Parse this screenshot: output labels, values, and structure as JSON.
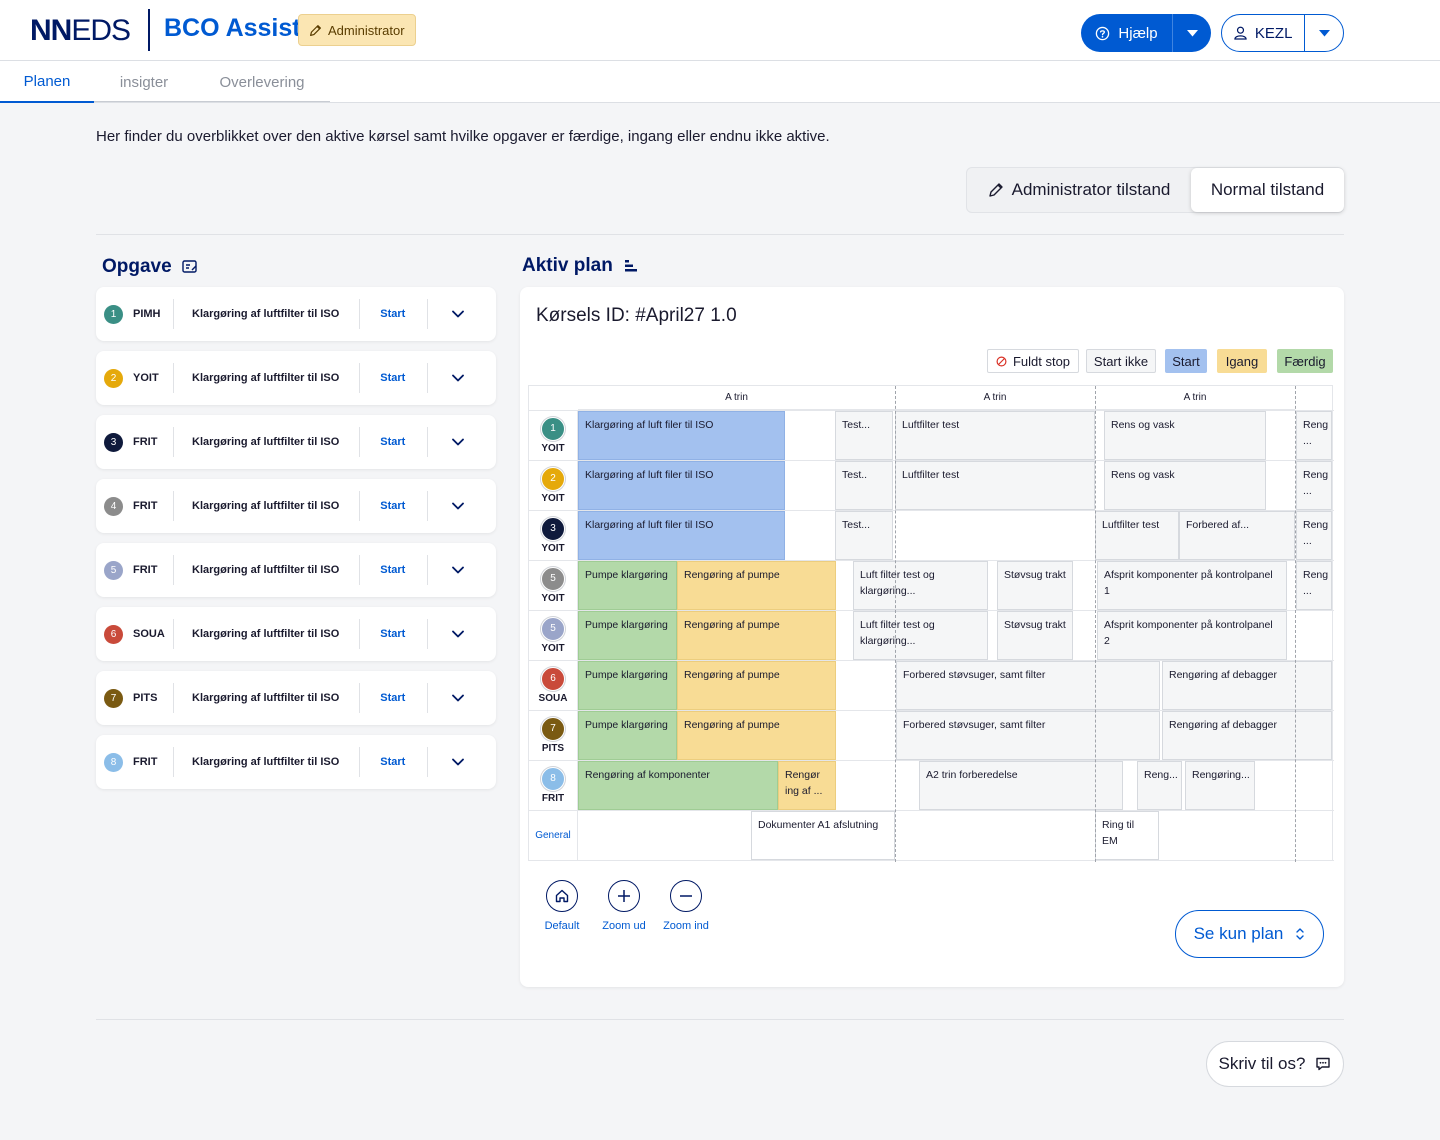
{
  "header": {
    "logo_bold": "NN",
    "logo_rest": "EDS",
    "app_name": "BCO Assist",
    "role_badge": "Administrator",
    "help_label": "Hjælp",
    "user_label": "KEZL",
    "brand_color": "#005ad2",
    "navy_color": "#001965"
  },
  "tabs": [
    {
      "label": "Planen",
      "active": true
    },
    {
      "label": "insigter",
      "active": false
    },
    {
      "label": "Overlevering",
      "active": false
    }
  ],
  "intro_text": "Her finder du overblikket over den aktive kørsel samt hvilke opgaver er færdige, ingang eller endnu ikke aktive.",
  "mode": {
    "admin_label": "Administrator tilstand",
    "normal_label": "Normal tilstand",
    "selected": "Normal tilstand"
  },
  "tasks_panel": {
    "title": "Opgave",
    "items": [
      {
        "num": "1",
        "code": "PIMH",
        "name": "Klargøring af luftfilter til ISO",
        "action": "Start",
        "color": "#3a8f85"
      },
      {
        "num": "2",
        "code": "YOIT",
        "name": "Klargøring af luftfilter til ISO",
        "action": "Start",
        "color": "#e5a90b"
      },
      {
        "num": "3",
        "code": "FRIT",
        "name": "Klargøring af luftfilter til ISO",
        "action": "Start",
        "color": "#0f1a3c"
      },
      {
        "num": "4",
        "code": "FRIT",
        "name": "Klargøring af luftfilter til ISO",
        "action": "Start",
        "color": "#8c8c8c"
      },
      {
        "num": "5",
        "code": "FRIT",
        "name": "Klargøring af luftfilter til ISO",
        "action": "Start",
        "color": "#9aa5c9"
      },
      {
        "num": "6",
        "code": "SOUA",
        "name": "Klargøring af luftfilter til ISO",
        "action": "Start",
        "color": "#c94a3a"
      },
      {
        "num": "7",
        "code": "PITS",
        "name": "Klargøring af luftfilter til ISO",
        "action": "Start",
        "color": "#7a5a12"
      },
      {
        "num": "8",
        "code": "FRIT",
        "name": "Klargøring af luftfilter til ISO",
        "action": "Start",
        "color": "#8bbde8"
      }
    ]
  },
  "plan": {
    "title": "Aktiv plan",
    "run_id": "Kørsels ID: #April27 1.0",
    "legend": [
      {
        "label": "Fuldt stop",
        "key": "stop"
      },
      {
        "label": "Start ikke",
        "key": "none"
      },
      {
        "label": "Start",
        "key": "start",
        "color": "#a3c1ef"
      },
      {
        "label": "Igang",
        "key": "igang",
        "color": "#f8dc95"
      },
      {
        "label": "Færdig",
        "key": "faerdig",
        "color": "#b3d9a9"
      }
    ],
    "phase_headers": [
      "A trin",
      "A trin",
      "A trin"
    ],
    "rows": [
      {
        "num": "1",
        "code": "YOIT",
        "color": "#3a8f85"
      },
      {
        "num": "2",
        "code": "YOIT",
        "color": "#e5a90b"
      },
      {
        "num": "3",
        "code": "YOIT",
        "color": "#0f1a3c"
      },
      {
        "num": "5",
        "code": "YOIT",
        "color": "#8c8c8c"
      },
      {
        "num": "5",
        "code": "YOIT",
        "color": "#9aa5c9"
      },
      {
        "num": "6",
        "code": "SOUA",
        "color": "#c94a3a"
      },
      {
        "num": "7",
        "code": "PITS",
        "color": "#7a5a12"
      },
      {
        "num": "8",
        "code": "FRIT",
        "color": "#8bbde8"
      }
    ],
    "general_label": "General",
    "blocks": [
      {
        "row": 0,
        "text": "Klargøring af luft filer til ISO",
        "status": "start"
      },
      {
        "row": 0,
        "text": "Test...",
        "status": "none"
      },
      {
        "row": 0,
        "text": "Luftfilter test",
        "status": "none"
      },
      {
        "row": 0,
        "text": "Rens og vask",
        "status": "none"
      },
      {
        "row": 0,
        "text": "Reng ...",
        "status": "none"
      },
      {
        "row": 1,
        "text": "Klargøring af luft filer til ISO",
        "status": "start"
      },
      {
        "row": 1,
        "text": "Test..",
        "status": "none"
      },
      {
        "row": 1,
        "text": "Luftfilter test",
        "status": "none"
      },
      {
        "row": 1,
        "text": "Rens og vask",
        "status": "none"
      },
      {
        "row": 1,
        "text": "Reng ...",
        "status": "none"
      },
      {
        "row": 2,
        "text": "Klargøring af luft filer til ISO",
        "status": "start"
      },
      {
        "row": 2,
        "text": "Test...",
        "status": "none"
      },
      {
        "row": 2,
        "text": "Luftfilter test",
        "status": "none"
      },
      {
        "row": 2,
        "text": "Forbered af...",
        "status": "none"
      },
      {
        "row": 2,
        "text": "Reng ...",
        "status": "none"
      },
      {
        "row": 3,
        "text": "Pumpe klargøring",
        "status": "faerdig"
      },
      {
        "row": 3,
        "text": "Rengøring af pumpe",
        "status": "igang"
      },
      {
        "row": 3,
        "text": "Luft filter test og klargøring...",
        "status": "none"
      },
      {
        "row": 3,
        "text": "Støvsug trakt",
        "status": "none"
      },
      {
        "row": 3,
        "text": "Afsprit komponenter på kontrolpanel 1",
        "status": "none"
      },
      {
        "row": 3,
        "text": "Reng ...",
        "status": "none"
      },
      {
        "row": 4,
        "text": "Pumpe klargøring",
        "status": "faerdig"
      },
      {
        "row": 4,
        "text": "Rengøring af pumpe",
        "status": "igang"
      },
      {
        "row": 4,
        "text": "Luft filter test og klargøring...",
        "status": "none"
      },
      {
        "row": 4,
        "text": "Støvsug trakt",
        "status": "none"
      },
      {
        "row": 4,
        "text": "Afsprit komponenter på kontrolpanel 2",
        "status": "none"
      },
      {
        "row": 5,
        "text": "Pumpe klargøring",
        "status": "faerdig"
      },
      {
        "row": 5,
        "text": "Rengøring af pumpe",
        "status": "igang"
      },
      {
        "row": 5,
        "text": "Forbered støvsuger, samt filter",
        "status": "none"
      },
      {
        "row": 5,
        "text": "Rengøring af debagger",
        "status": "none"
      },
      {
        "row": 6,
        "text": "Pumpe klargøring",
        "status": "faerdig"
      },
      {
        "row": 6,
        "text": "Rengøring af pumpe",
        "status": "igang"
      },
      {
        "row": 6,
        "text": "Forbered støvsuger, samt filter",
        "status": "none"
      },
      {
        "row": 6,
        "text": "Rengøring af debagger",
        "status": "none"
      },
      {
        "row": 7,
        "text": "Rengøring af komponenter",
        "status": "faerdig"
      },
      {
        "row": 7,
        "text": "Rengør ing af ...",
        "status": "igang"
      },
      {
        "row": 7,
        "text": "A2 trin forberedelse",
        "status": "none"
      },
      {
        "row": 7,
        "text": "Reng...",
        "status": "none"
      },
      {
        "row": 7,
        "text": "Rengøring...",
        "status": "none"
      },
      {
        "row": 8,
        "text": "Dokumenter A1 afslutning",
        "status": "white"
      },
      {
        "row": 8,
        "text": "Ring til EM",
        "status": "white"
      }
    ],
    "zoom": [
      {
        "label": "Default",
        "icon": "home-icon"
      },
      {
        "label": "Zoom ud",
        "icon": "plus-icon"
      },
      {
        "label": "Zoom ind",
        "icon": "minus-icon"
      }
    ],
    "view_toggle_label": "Se kun plan"
  },
  "feedback_label": "Skriv til os?"
}
